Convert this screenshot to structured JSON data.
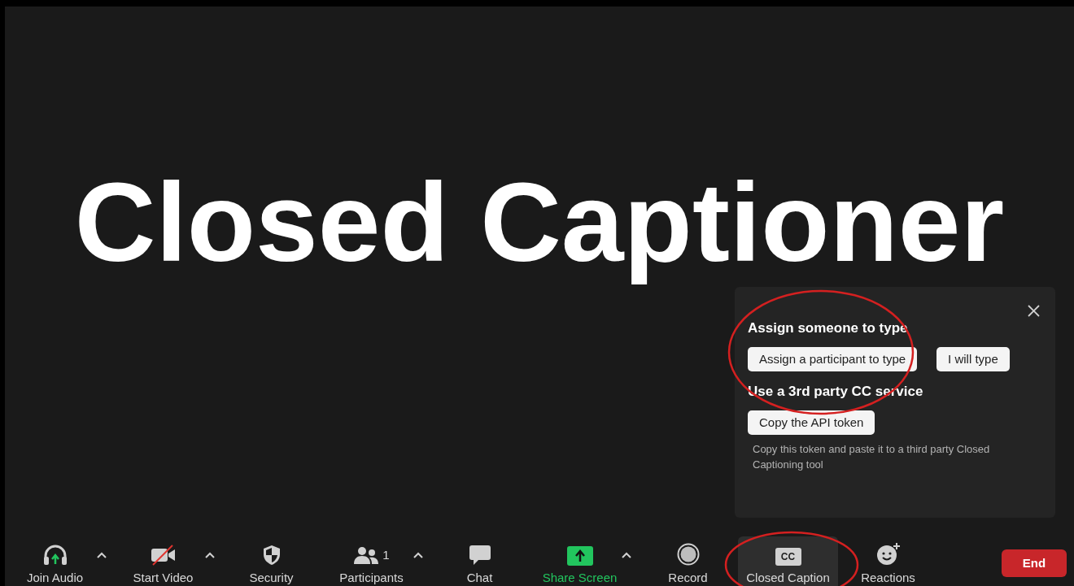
{
  "slide": {
    "title": "Closed Captioner"
  },
  "cc_popup": {
    "sections": [
      {
        "heading": "Assign someone to type",
        "buttons": [
          "Assign a participant to type",
          "I will type"
        ]
      },
      {
        "heading": "Use a 3rd party CC service",
        "buttons": [
          "Copy the API token"
        ],
        "note": "Copy this token and paste it to a third party Closed Captioning tool"
      }
    ]
  },
  "toolbar": {
    "items": [
      {
        "kind": "audio",
        "label": "Join Audio",
        "menu": true,
        "selected": false
      },
      {
        "kind": "video",
        "label": "Start Video",
        "menu": true,
        "selected": false
      },
      {
        "kind": "security",
        "label": "Security",
        "menu": false,
        "selected": false
      },
      {
        "kind": "participants",
        "label": "Participants",
        "count": "1",
        "menu": true,
        "selected": false
      },
      {
        "kind": "chat",
        "label": "Chat",
        "menu": false,
        "selected": false
      },
      {
        "kind": "share",
        "label": "Share Screen",
        "menu": true,
        "selected": false
      },
      {
        "kind": "record",
        "label": "Record",
        "menu": false,
        "selected": false
      },
      {
        "kind": "captions",
        "label": "Closed Caption",
        "icon_text": "CC",
        "menu": false,
        "selected": true
      },
      {
        "kind": "reactions",
        "label": "Reactions",
        "menu": false,
        "selected": false
      }
    ],
    "end_button": "End"
  }
}
